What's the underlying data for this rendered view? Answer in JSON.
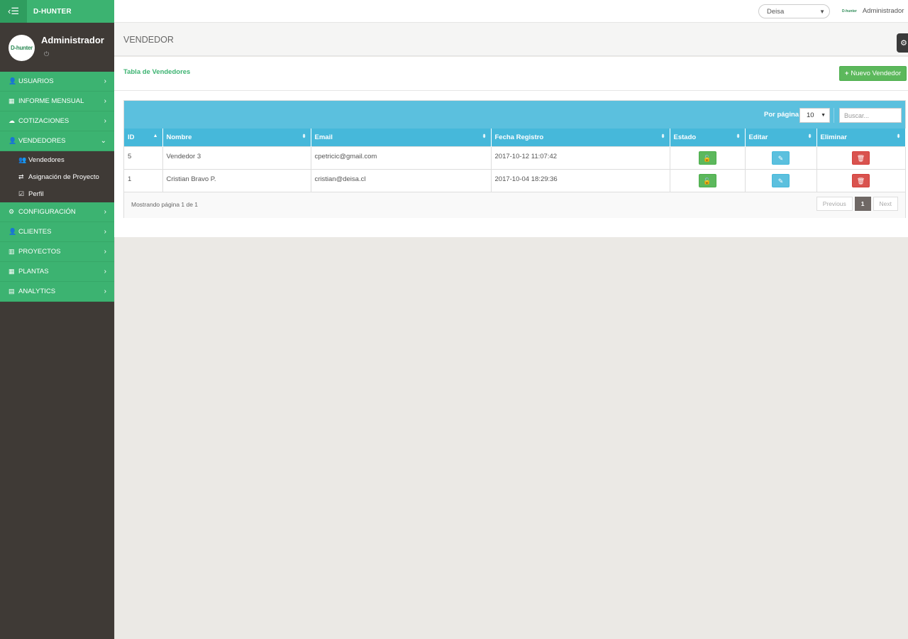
{
  "brand": {
    "name": "D-HUNTER",
    "logo_text": "D-hunter"
  },
  "profile": {
    "name": "Administrador"
  },
  "menu": {
    "usuarios": "USUARIOS",
    "informe": "INFORME MENSUAL",
    "cotizaciones": "COTIZACIONES",
    "vendedores": "VENDEDORES",
    "sub_vendedores": "Vendedores",
    "sub_asignacion": "Asignación de Proyecto",
    "sub_perfil": "Perfil",
    "configuracion": "CONFIGURACIÓN",
    "clientes": "CLIENTES",
    "proyectos": "PROYECTOS",
    "plantas": "PLANTAS",
    "analytics": "ANALYTICS"
  },
  "topbar": {
    "company": "Deisa",
    "user": "Administrador"
  },
  "page": {
    "title": "VENDEDOR"
  },
  "panel": {
    "title": "Tabla de Vendedores",
    "new_button": "Nuevo Vendedor"
  },
  "table": {
    "per_page_label": "Por página:",
    "per_page_value": "10",
    "search_placeholder": "Buscar...",
    "headers": {
      "id": "ID",
      "nombre": "Nombre",
      "email": "Email",
      "fecha": "Fecha Registro",
      "estado": "Estado",
      "editar": "Editar",
      "eliminar": "Eliminar"
    },
    "rows": [
      {
        "id": "5",
        "nombre": "Vendedor 3",
        "email": "cpetricic@gmail.com",
        "fecha": "2017-10-12 11:07:42"
      },
      {
        "id": "1",
        "nombre": "Cristian Bravo P.",
        "email": "cristian@deisa.cl",
        "fecha": "2017-10-04 18:29:36"
      }
    ],
    "footer_info": "Mostrando página 1 de 1",
    "pager": {
      "previous": "Previous",
      "current": "1",
      "next": "Next"
    }
  },
  "colors": {
    "accent": "#3cb371",
    "sidebar": "#3f3a36",
    "table_header": "#46b8da",
    "toolbar": "#5bc0de",
    "danger": "#d9534f",
    "success": "#5cb85c"
  }
}
